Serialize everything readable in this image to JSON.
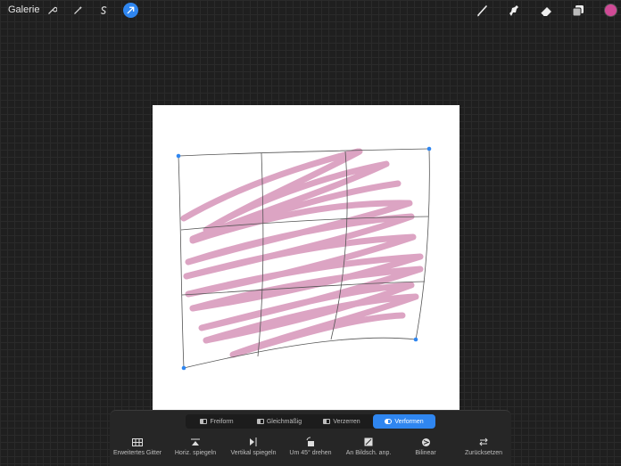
{
  "topbar": {
    "gallery_label": "Galerie",
    "left_tools": [
      {
        "icon": "wrench-icon",
        "active": false
      },
      {
        "icon": "magic-wand-icon",
        "active": false
      },
      {
        "icon": "selection-icon",
        "active": false
      },
      {
        "icon": "transform-arrow-icon",
        "active": true
      }
    ],
    "right_tools": [
      "brush-icon",
      "smudge-icon",
      "eraser-icon",
      "layers-icon"
    ],
    "current_color": "#d04a96"
  },
  "stroke_color": "#dba0c0",
  "accent_color": "#2f86f0",
  "transform_modes": [
    {
      "label": "Freiform",
      "active": false
    },
    {
      "label": "Gleichmäßig",
      "active": false
    },
    {
      "label": "Verzerren",
      "active": false
    },
    {
      "label": "Verformen",
      "active": true
    }
  ],
  "actions": [
    {
      "label": "Erweitertes Gitter",
      "icon": "grid-icon"
    },
    {
      "label": "Horiz. spiegeln",
      "icon": "flip-horizontal-icon"
    },
    {
      "label": "Vertikal spiegeln",
      "icon": "flip-vertical-icon"
    },
    {
      "label": "Um 45° drehen",
      "icon": "rotate-45-icon"
    },
    {
      "label": "An Bildsch. anp.",
      "icon": "fit-screen-icon"
    },
    {
      "label": "Bilinear",
      "icon": "bilinear-icon"
    },
    {
      "label": "Zurücksetzen",
      "icon": "reset-icon"
    }
  ]
}
